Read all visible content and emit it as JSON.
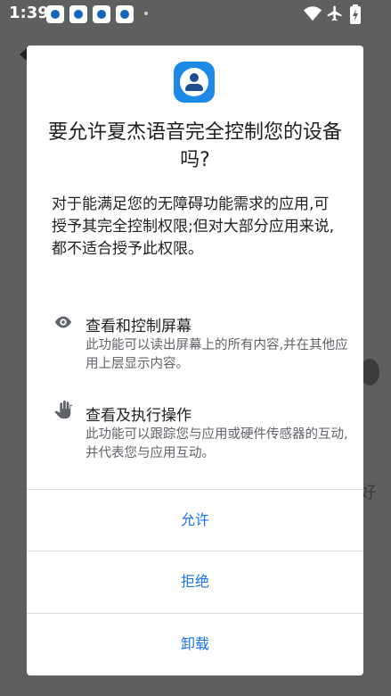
{
  "status_bar": {
    "time": "1:39",
    "notification_icons": [
      "paw-icon",
      "paw-icon",
      "paw-icon",
      "paw-icon"
    ],
    "right_icons": [
      "wifi-icon",
      "airplane-icon",
      "battery-charging-icon"
    ]
  },
  "dialog": {
    "title": "要允许夏杰语音完全控制您的设备吗?",
    "description": "对于能满足您的无障碍功能需求的应用,可授予其完全控制权限;但对大部分应用来说,都不适合授予此权限。",
    "permissions": [
      {
        "icon": "eye-icon",
        "title": "查看和控制屏幕",
        "description": "此功能可以读出屏幕上的所有内容,并在其他应用上层显示内容。"
      },
      {
        "icon": "hand-icon",
        "title": "查看及执行操作",
        "description": "此功能可以跟踪您与应用或硬件传感器的互动,并代表您与应用互动。"
      }
    ],
    "buttons": {
      "allow": "允许",
      "deny": "拒绝",
      "uninstall": "卸载"
    }
  },
  "background": {
    "partial_text": "好"
  },
  "colors": {
    "accent": "#1a73e8",
    "scrim": "#5f5f5f",
    "app_icon": "#1e88e5"
  }
}
